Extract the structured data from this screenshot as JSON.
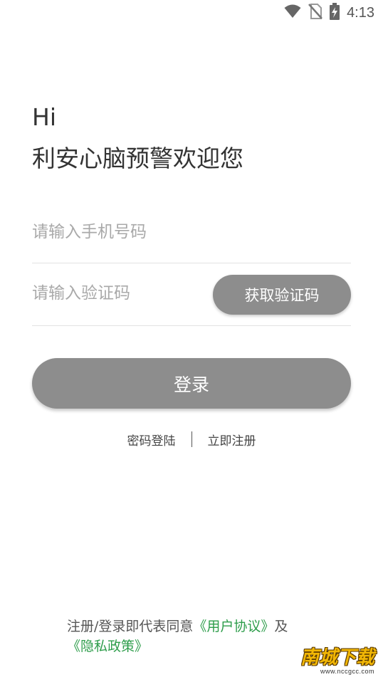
{
  "status_bar": {
    "time": "4:13",
    "icons": [
      "wifi-icon",
      "no-sim-icon",
      "battery-charging-icon"
    ]
  },
  "header": {
    "greeting_line1": "Hi",
    "greeting_line2": "利安心脑预警欢迎您"
  },
  "form": {
    "phone_placeholder": "请输入手机号码",
    "phone_value": "",
    "code_placeholder": "请输入验证码",
    "code_value": "",
    "get_code_label": "获取验证码",
    "login_label": "登录"
  },
  "links": {
    "password_login": "密码登陆",
    "register_now": "立即注册"
  },
  "agreement": {
    "prefix": "注册/登录即代表同意",
    "user_agreement": "《用户协议》",
    "and": "及",
    "privacy_policy": "《隐私政策》"
  },
  "watermark": {
    "title": "南城下载",
    "url": "www.nccgcc.com"
  },
  "colors": {
    "button_bg": "#8d8d8d",
    "link_green": "#2e9d4b",
    "divider": "#e2e2e2"
  }
}
